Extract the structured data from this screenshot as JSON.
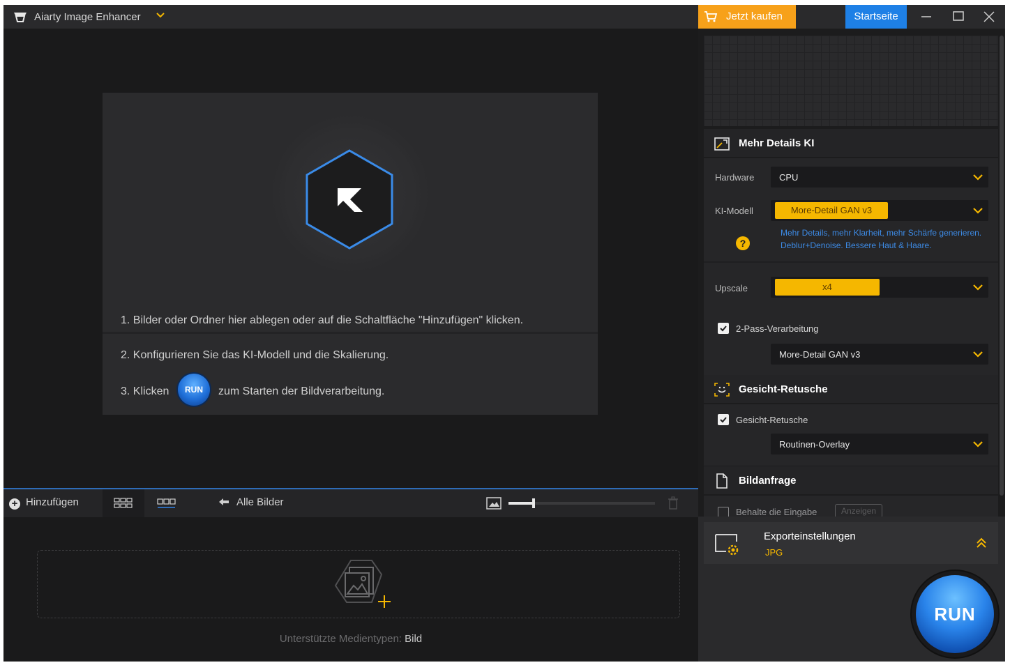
{
  "app": {
    "title": "Aiarty Image Enhancer"
  },
  "topbar": {
    "buy_label": "Jetzt kaufen",
    "home_label": "Startseite"
  },
  "drop_area": {
    "step1": "1. Bilder oder Ordner hier ablegen oder auf die Schaltfläche \"Hinzufügen\" klicken.",
    "step2": "2. Konfigurieren Sie das KI-Modell und die Skalierung.",
    "step3_prefix": "3. Klicken",
    "step3_run": "RUN",
    "step3_suffix": "zum Starten der Bildverarbeitung."
  },
  "thumbbar": {
    "add_label": "Hinzufügen",
    "all_images_label": "Alle Bilder",
    "zoom_level": 0.17
  },
  "bottom": {
    "supported_label": "Unterstützte Medientypen:",
    "supported_value": "Bild"
  },
  "panel": {
    "section1": {
      "title": "Mehr Details KI",
      "hardware_label": "Hardware",
      "hardware_value": "CPU",
      "model_label": "KI-Modell",
      "model_value": "More-Detail GAN  v3",
      "model_desc": "Mehr Details, mehr Klarheit, mehr Schärfe generieren. Deblur+Denoise. Bessere Haut & Haare.",
      "upscale_label": "Upscale",
      "upscale_value": "x4",
      "twopass_label": "2-Pass-Verarbeitung",
      "twopass_checked": true,
      "twopass_model": "More-Detail GAN  v3"
    },
    "section2": {
      "title": "Gesicht-Retusche",
      "checkbox_label": "Gesicht-Retusche",
      "checked": true,
      "mode_value": "Routinen-Overlay"
    },
    "section3": {
      "title": "Bildanfrage",
      "keep_input_label": "Behalte die Eingabe",
      "show_label": "Anzeigen"
    },
    "export": {
      "title": "Exporteinstellungen",
      "format": "JPG"
    },
    "run_label": "RUN"
  },
  "colors": {
    "accent_orange": "#f7a11a",
    "accent_blue": "#1e80e6",
    "highlight_yellow": "#f5b700",
    "hex_outline": "#3a8be8"
  },
  "icons": [
    "app-logo-icon",
    "chevron-down-icon",
    "cart-icon",
    "minimize-icon",
    "maximize-icon",
    "close-icon",
    "hexagon-logo-icon",
    "plus-icon",
    "grid-view-icon",
    "strip-view-icon",
    "back-arrow-icon",
    "image-zoom-icon",
    "trash-icon",
    "add-media-icon",
    "enhance-icon",
    "face-icon",
    "document-icon",
    "export-settings-icon",
    "help-icon",
    "double-chevron-up-icon"
  ]
}
